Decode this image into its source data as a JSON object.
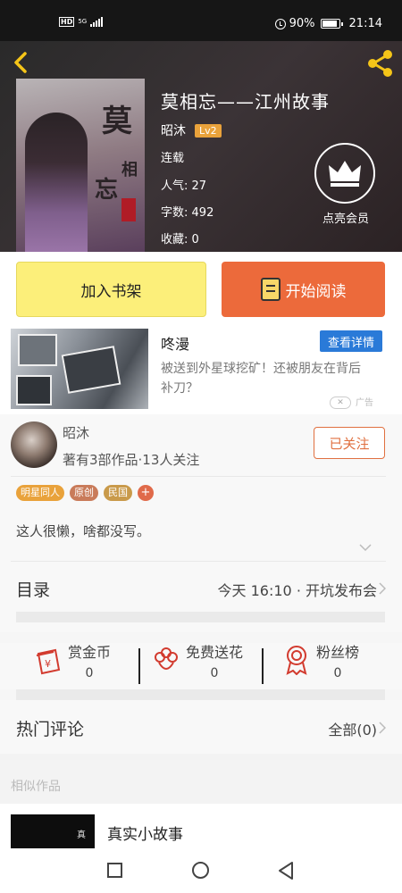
{
  "status_bar": {
    "hd": "HD",
    "network": "5G",
    "battery": "90%",
    "time": "21:14"
  },
  "book": {
    "title": "莫相忘——江州故事",
    "author": "昭沐",
    "level": "Lv2",
    "status": "连载",
    "popularity_label": "人气:",
    "popularity_value": "27",
    "words_label": "字数:",
    "words_value": "492",
    "favorites_label": "收藏:",
    "favorites_value": "0",
    "cover_chars": [
      "莫",
      "相",
      "忘"
    ]
  },
  "vip": {
    "label": "点亮会员"
  },
  "actions": {
    "add_shelf": "加入书架",
    "start_reading": "开始阅读"
  },
  "ad": {
    "title": "咚漫",
    "detail_button": "查看详情",
    "description": "被送到外星球挖矿！还被朋友在背后补刀？",
    "close": "✕",
    "mark": "广告"
  },
  "author_card": {
    "name": "昭沐",
    "stats": "著有3部作品·13人关注",
    "follow_button": "已关注",
    "tags": [
      {
        "label": "明星同人",
        "color": "#e9a23b"
      },
      {
        "label": "原创",
        "color": "#c97b5a"
      },
      {
        "label": "民国",
        "color": "#c99a4a"
      }
    ],
    "add_tag": "+",
    "bio": "这人很懒，啥都没写。"
  },
  "toc": {
    "label": "目录",
    "latest": "今天 16:10 · 开坑发布会"
  },
  "gifts": [
    {
      "label": "赏金币",
      "count": "0",
      "icon": "coin-gift-icon"
    },
    {
      "label": "免费送花",
      "count": "0",
      "icon": "flower-icon"
    },
    {
      "label": "粉丝榜",
      "count": "0",
      "icon": "medal-icon"
    }
  ],
  "comments": {
    "label": "热门评论",
    "all": "全部(0)"
  },
  "similar": {
    "heading": "相似作品",
    "items": [
      {
        "title": "真实小故事"
      }
    ]
  },
  "colors": {
    "accent_orange": "#ec6a3b",
    "shelf_yellow": "#fcef7a",
    "ad_blue": "#2a7ad8"
  }
}
